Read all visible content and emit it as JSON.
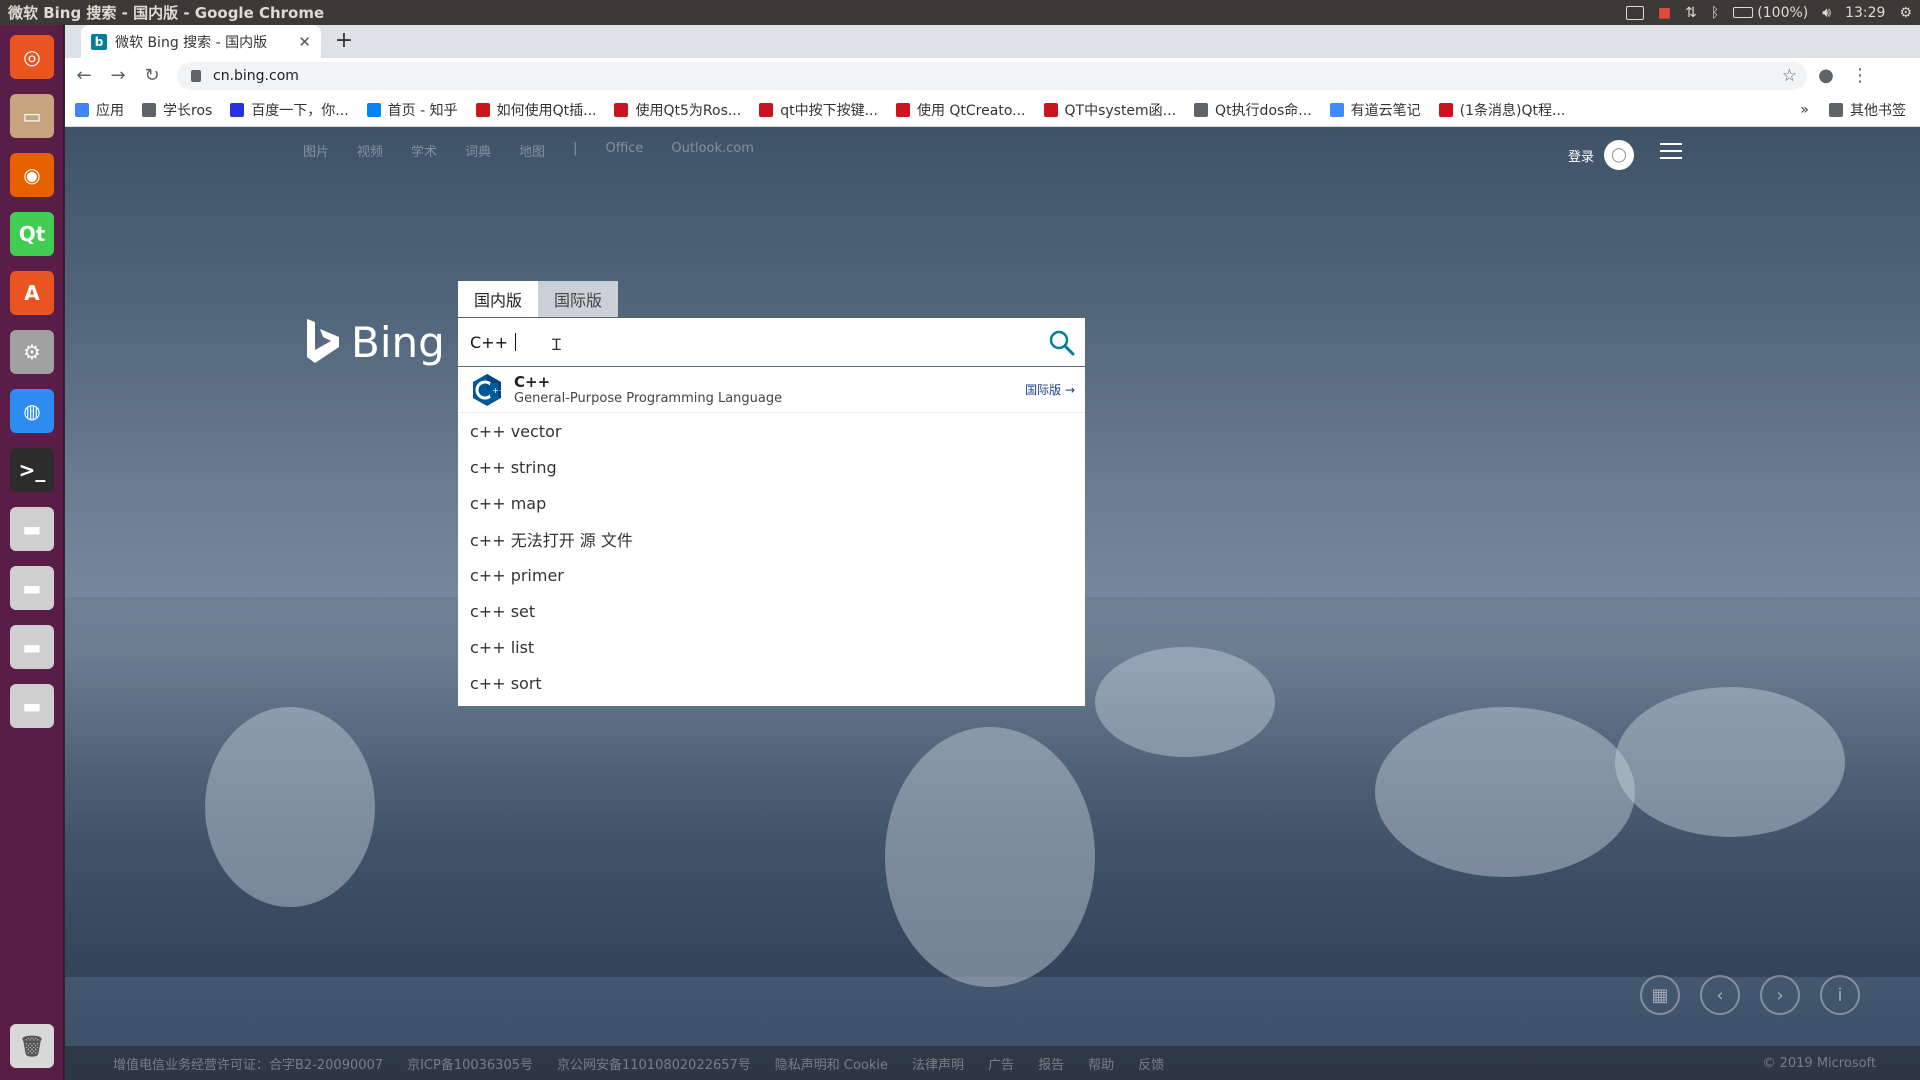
{
  "panel": {
    "title": "微软 Bing 搜索 - 国内版 - Google Chrome",
    "battery": "(100%)",
    "time": "13:29"
  },
  "launcher": {
    "items": [
      {
        "name": "ubuntu-dash-icon",
        "color": "#e95420",
        "glyph": "◎"
      },
      {
        "name": "files-icon",
        "color": "#c7a47e",
        "glyph": "▭"
      },
      {
        "name": "firefox-icon",
        "color": "#e66000",
        "glyph": "◉"
      },
      {
        "name": "qt-creator-icon",
        "color": "#41cd52",
        "glyph": "Qt"
      },
      {
        "name": "software-center-icon",
        "color": "#e95420",
        "glyph": "A"
      },
      {
        "name": "settings-icon",
        "color": "#a0a0a0",
        "glyph": "⚙"
      },
      {
        "name": "chrome-icon",
        "color": "#2d8cf0",
        "glyph": "◍"
      },
      {
        "name": "terminal-icon",
        "color": "#2c2c2c",
        "glyph": ">_"
      },
      {
        "name": "drive-icon",
        "color": "#cfcfcf",
        "glyph": "▬"
      },
      {
        "name": "drive-icon",
        "color": "#cfcfcf",
        "glyph": "▬"
      },
      {
        "name": "drive-icon",
        "color": "#cfcfcf",
        "glyph": "▬"
      },
      {
        "name": "drive-icon",
        "color": "#cfcfcf",
        "glyph": "▬"
      }
    ],
    "trash_glyph": "🗑"
  },
  "browser": {
    "tab_title": "微软 Bing 搜索 - 国内版",
    "tab_favicon": "b",
    "url": "cn.bing.com"
  },
  "bookmarks": {
    "items": [
      {
        "label": "应用",
        "color": "#4285f4"
      },
      {
        "label": "学长ros",
        "color": "#5f6368"
      },
      {
        "label": "百度一下，你...",
        "color": "#2932e1"
      },
      {
        "label": "首页 - 知乎",
        "color": "#0084ff"
      },
      {
        "label": "如何使用Qt插...",
        "color": "#c9151e"
      },
      {
        "label": "使用Qt5为Ros...",
        "color": "#c9151e"
      },
      {
        "label": "qt中按下按键...",
        "color": "#c9151e"
      },
      {
        "label": "使用 QtCreato...",
        "color": "#c9151e"
      },
      {
        "label": "QT中system函...",
        "color": "#c9151e"
      },
      {
        "label": "Qt执行dos命...",
        "color": "#5f6368"
      },
      {
        "label": "有道云笔记",
        "color": "#3d8bff"
      },
      {
        "label": "(1条消息)Qt程...",
        "color": "#c9151e"
      }
    ],
    "more": "»",
    "other": "其他书签"
  },
  "bing": {
    "topnav": [
      "图片",
      "视频",
      "学术",
      "词典",
      "地图",
      "|",
      "Office",
      "Outlook.com"
    ],
    "login": "登录",
    "logo_text": "Bing",
    "search_tabs": {
      "domestic": "国内版",
      "international": "国际版"
    },
    "query": "C++ ",
    "entity": {
      "title": "C++",
      "subtitle": "General-Purpose Programming Language",
      "link": "国际版"
    },
    "suggestions": [
      "c++ vector",
      "c++ string",
      "c++ map",
      "c++ 无法打开 源 文件",
      "c++ primer",
      "c++ set",
      "c++ list",
      "c++ sort"
    ],
    "footer": [
      "增值电信业务经营许可证：合字B2-20090007",
      "京ICP备10036305号",
      "京公网安备11010802022657号",
      "隐私声明和 Cookie",
      "法律声明",
      "广告",
      "报告",
      "帮助",
      "反馈"
    ],
    "copyright": "© 2019 Microsoft",
    "accent": "#00809d"
  }
}
